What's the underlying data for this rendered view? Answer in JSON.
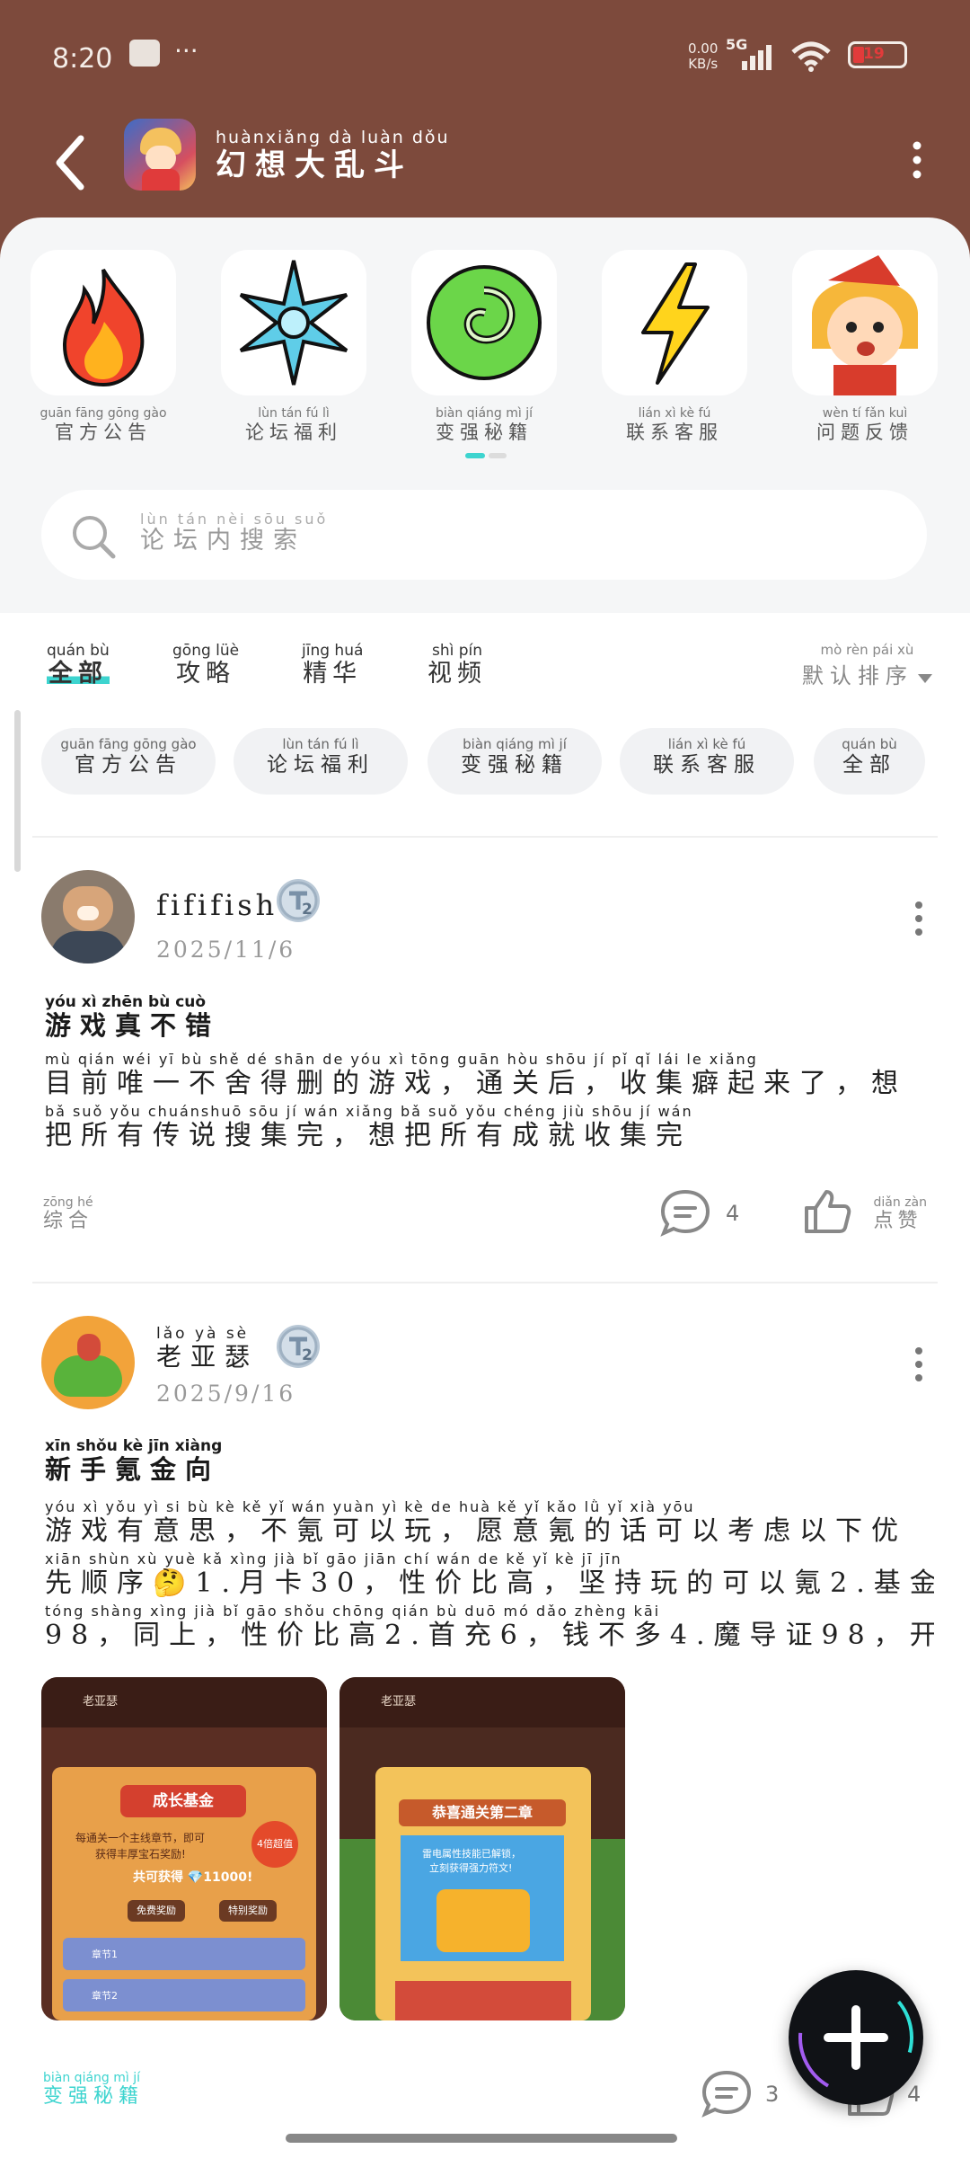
{
  "status_bar": {
    "time": "8:20",
    "more": "···",
    "net_speed_top": "0.00",
    "net_speed_bottom": "KB/s",
    "network": "5G",
    "battery": "19"
  },
  "header": {
    "title_pinyin": "huànxiǎng dà luàn dǒu",
    "title": "幻想大乱斗"
  },
  "shortcuts": [
    {
      "pinyin": "guān fāng gōng gào",
      "label": "官方公告",
      "icon": "fire-icon"
    },
    {
      "pinyin": "lùn tán fú lì",
      "label": "论坛福利",
      "icon": "snowflake-icon"
    },
    {
      "pinyin": "biàn qiáng mì jí",
      "label": "变强秘籍",
      "icon": "swirl-icon"
    },
    {
      "pinyin": "lián xì kè fú",
      "label": "联系客服",
      "icon": "lightning-icon"
    },
    {
      "pinyin": "wèn tí fǎn kuì",
      "label": "问题反馈",
      "icon": "character-icon"
    }
  ],
  "search": {
    "pinyin": "lùn tán nèi sōu suǒ",
    "placeholder": "论坛内搜索"
  },
  "tabs": [
    {
      "pinyin": "quán bù",
      "label": "全部"
    },
    {
      "pinyin": "gōng lüè",
      "label": "攻略"
    },
    {
      "pinyin": "jīng huá",
      "label": "精华"
    },
    {
      "pinyin": "shì pín",
      "label": "视频"
    }
  ],
  "sort": {
    "pinyin": "mò rèn pái xù",
    "label": "默认排序"
  },
  "chips": [
    {
      "pinyin": "guān fāng gōng gào",
      "label": "官方公告"
    },
    {
      "pinyin": "lùn tán fú lì",
      "label": "论坛福利"
    },
    {
      "pinyin": "biàn qiáng mì jí",
      "label": "变强秘籍"
    },
    {
      "pinyin": "lián xì kè fú",
      "label": "联系客服"
    },
    {
      "pinyin": "quán bù",
      "label": "全部"
    }
  ],
  "posts": [
    {
      "username": "fififish",
      "username_pinyin": "",
      "level": "2",
      "date": "2025/11/6",
      "title_pinyin": "yóu xì zhēn bù cuò",
      "title": "游戏真不错",
      "lines": [
        {
          "pinyin": "mù qián wéi yī bù shě dé shān de yóu xì tōng guān hòu shōu jí pǐ qǐ lái le xiǎng",
          "text": "目前唯一不舍得删的游戏，通关后，收集癖起来了，想"
        },
        {
          "pinyin": "bǎ suǒ yǒu chuánshuō sōu jí wán xiǎng bǎ suǒ yǒu chéng jiù shōu jí wán",
          "text": "把所有传说搜集完，想把所有成就收集完"
        }
      ],
      "tag_pinyin": "zōng hé",
      "tag": "综合",
      "comments": "4",
      "like_pinyin": "diǎn zàn",
      "like_label": "点赞"
    },
    {
      "username": "老亚瑟",
      "username_pinyin": "lǎo yà sè",
      "level": "2",
      "date": "2025/9/16",
      "title_pinyin": "xīn shǒu kè jīn xiàng",
      "title": "新手氪金向",
      "lines": [
        {
          "pinyin": "yóu xì yǒu yì si bù kè kě yǐ wán yuàn yì kè de huà kě yǐ kǎo lǜ yǐ xià yōu",
          "text": "游戏有意思，不氪可以玩，愿意氪的话可以考虑以下优"
        },
        {
          "pinyin": "xiān shùn xù yuè kǎ xìng jià bǐ gāo jiān chí wán de kě yǐ kè jī jīn",
          "text": "先顺序🤔1.月卡30，性价比高，坚持玩的可以氪2.基金"
        },
        {
          "pinyin": "tóng shàng xìng jià bǐ gāo shǒu chōng qián bù duō mó dǎo zhèng kāi",
          "text": "98，同上，性价比高2.首充6，钱不多4.魔导证98，开…"
        }
      ],
      "images": [
        {
          "caption": "成长基金",
          "line1": "每通关一个主线章节，即可",
          "line2": "获得丰厚宝石奖励!",
          "badge": "4倍超值",
          "total": "共可获得 💎11000!",
          "btn1": "免费奖励",
          "btn2": "特别奖励",
          "row1": "章节1",
          "row2": "章节2",
          "player": "老亚瑟"
        },
        {
          "caption": "恭喜通关第二章",
          "line1": "雷电属性技能已解锁，",
          "line2": "立刻获得强力符文!",
          "player": "老亚瑟"
        }
      ],
      "tag_pinyin": "biàn qiáng mì jí",
      "tag": "变强秘籍",
      "comments": "3",
      "likes": "4"
    }
  ],
  "colors": {
    "header_bg": "#7d4a3c",
    "accent": "#3dd4cf",
    "chip_bg": "#f1f2f4"
  }
}
